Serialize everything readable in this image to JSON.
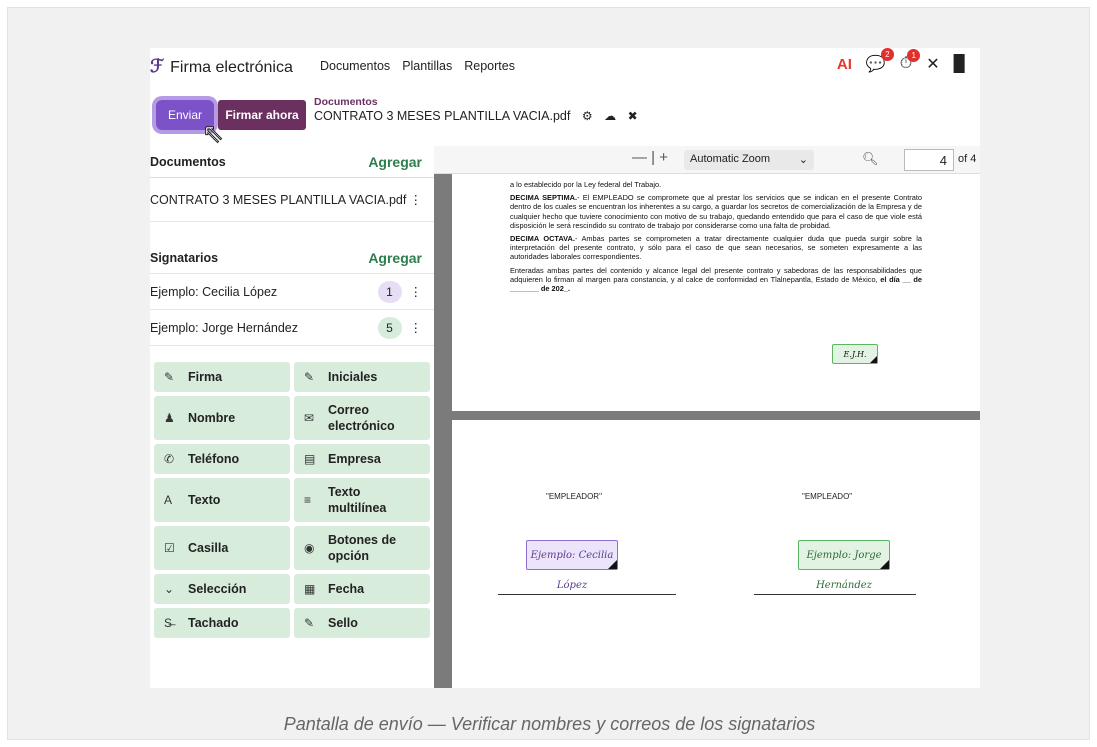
{
  "nav": {
    "brand": "Firma electrónica",
    "links": [
      "Documentos",
      "Plantillas",
      "Reportes"
    ],
    "icons": [
      {
        "name": "ai-icon",
        "glyph": "AI",
        "badge": ""
      },
      {
        "name": "chat-icon",
        "glyph": "💬",
        "badge": "2"
      },
      {
        "name": "clock-icon",
        "glyph": "⏱",
        "badge": "1"
      },
      {
        "name": "tools-icon",
        "glyph": "✕",
        "badge": ""
      },
      {
        "name": "building-icon",
        "glyph": "▉",
        "badge": ""
      }
    ]
  },
  "actions": {
    "enviar": "Enviar",
    "firmar": "Firmar ahora"
  },
  "breadcrumb": {
    "section": "Documentos",
    "file": "CONTRATO 3 MESES PLANTILLA VACIA.pdf"
  },
  "sidebar": {
    "documents_title": "Documentos",
    "add_label": "Agregar",
    "document": "CONTRATO 3 MESES PLANTILLA VACIA.pdf",
    "signers_title": "Signatarios",
    "signers": [
      {
        "name": "Ejemplo: Cecilia López",
        "count": "1",
        "color": "#e6def5"
      },
      {
        "name": "Ejemplo: Jorge Hernández",
        "count": "5",
        "color": "#d8ecdc"
      }
    ],
    "fields": [
      {
        "icon": "✎",
        "iconName": "pen-icon",
        "label": "Firma"
      },
      {
        "icon": "✎",
        "iconName": "pen-icon",
        "label": "Iniciales"
      },
      {
        "icon": "♟",
        "iconName": "user-icon",
        "label": "Nombre"
      },
      {
        "icon": "✉",
        "iconName": "envelope-icon",
        "label": "Correo electrónico"
      },
      {
        "icon": "✆",
        "iconName": "phone-icon",
        "label": "Teléfono"
      },
      {
        "icon": "▤",
        "iconName": "building-icon",
        "label": "Empresa"
      },
      {
        "icon": "A",
        "iconName": "text-icon",
        "label": "Texto"
      },
      {
        "icon": "≡",
        "iconName": "lines-icon",
        "label": "Texto multilínea"
      },
      {
        "icon": "☑",
        "iconName": "checkbox-icon",
        "label": "Casilla"
      },
      {
        "icon": "◉",
        "iconName": "radio-icon",
        "label": "Botones de opción"
      },
      {
        "icon": "⌄",
        "iconName": "chevron-down-icon",
        "label": "Selección"
      },
      {
        "icon": "▦",
        "iconName": "calendar-icon",
        "label": "Fecha"
      },
      {
        "icon": "S̶",
        "iconName": "strikethrough-icon",
        "label": "Tachado"
      },
      {
        "icon": "✎",
        "iconName": "pen-icon",
        "label": "Sello"
      }
    ]
  },
  "viewer": {
    "zoom": "Automatic Zoom",
    "page": "4",
    "of": "of 4",
    "intro": "a lo establecido por la Ley federal del Trabajo.",
    "clause1_head": "DECIMA SEPTIMA.",
    "clause1_body": "- El EMPLEADO se compromete que al prestar los servicios que se indican en el presente Contrato dentro de los cuales se encuentran los inherentes a su cargo, a guardar los secretos de comercialización de la Empresa y de cualquier hecho que tuviere conocimiento con motivo de su trabajo, quedando entendido que para el caso de que viole está disposición le será rescindido su contrato de trabajo por considerarse como una falta de probidad.",
    "clause2_head": "DECIMA OCTAVA.",
    "clause2_body": "- Ambas partes se comprometen a tratar directamente cualquier duda que pueda surgir sobre la interpretación del presente contrato, y sólo para el caso de que sean necesarios, se someten expresamente a las autoridades laborales correspondientes.",
    "closing": "Enteradas ambas partes del contenido y alcance legal del presente contrato y sabedoras de las responsabilidades que adquieren lo firman al margen para constancia, y al calce de conformidad en Tlalnepantla, Estado de México, ",
    "closing_bold": "el día __ de _______ de 202_.",
    "initials": "E.J.H.",
    "employer_label": "\"EMPLEADOR\"",
    "employee_label": "\"EMPLEADO\"",
    "sig_employer": "Ejemplo: Cecilia López",
    "sig_employee": "Ejemplo: Jorge Hernández"
  },
  "caption": "Pantalla de envío — Verificar nombres y correos de los signatarios"
}
